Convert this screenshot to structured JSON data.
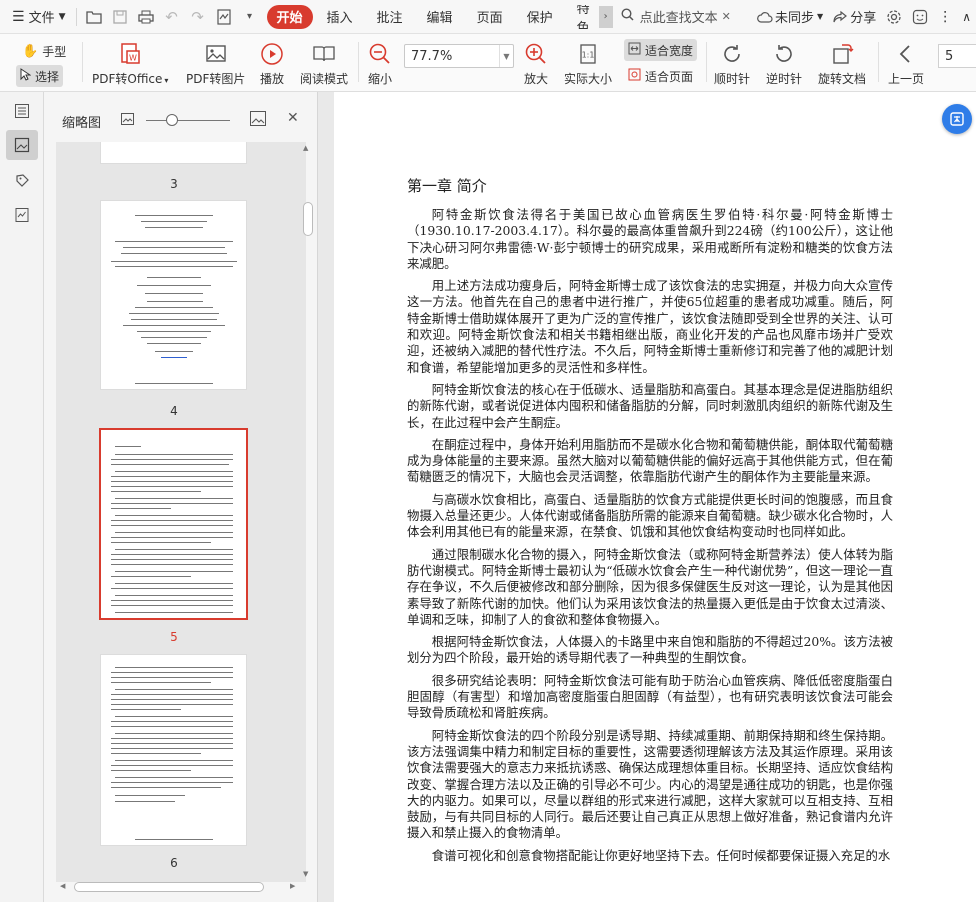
{
  "menubar": {
    "file_label": "文件",
    "tabs": [
      "开始",
      "插入",
      "批注",
      "编辑",
      "页面",
      "保护",
      "特色"
    ],
    "active_tab": "开始",
    "search_label": "点此查找文本",
    "sync_label": "未同步",
    "share_label": "分享"
  },
  "toolbar": {
    "hand_label": "手型",
    "select_label": "选择",
    "pdf_to_office": "PDF转Office",
    "pdf_to_image": "PDF转图片",
    "play": "播放",
    "read_mode": "阅读模式",
    "zoom_out": "缩小",
    "zoom_value": "77.7%",
    "zoom_in": "放大",
    "actual_size": "实际大小",
    "fit_width": "适合宽度",
    "fit_page": "适合页面",
    "rotate_cw": "顺时针",
    "rotate_ccw": "逆时针",
    "rotate_doc": "旋转文档",
    "prev_page": "上一页",
    "page_input": "5"
  },
  "thumbnail_panel": {
    "title": "缩略图",
    "pages": [
      "3",
      "4",
      "5",
      "6"
    ],
    "selected_page": "5"
  },
  "document": {
    "chapter_title": "第一章 简介",
    "paragraphs": [
      "阿特金斯饮食法得名于美国已故心血管病医生罗伯特·科尔曼·阿特金斯博士（1930.10.17-2003.4.17）。科尔曼的最高体重曾飙升到224磅（约100公斤），这让他下决心研习阿尔弗雷德·W·彭宁顿博士的研究成果，采用戒断所有淀粉和糖类的饮食方法来减肥。",
      "用上述方法成功瘦身后，阿特金斯博士成了该饮食法的忠实拥趸，并极力向大众宣传这一方法。他首先在自己的患者中进行推广，并使65位超重的患者成功减重。随后，阿特金斯博士借助媒体展开了更为广泛的宣传推广，该饮食法随即受到全世界的关注、认可和欢迎。阿特金斯饮食法和相关书籍相继出版，商业化开发的产品也风靡市场并广受欢迎，还被纳入减肥的替代性疗法。不久后，阿特金斯博士重新修订和完善了他的减肥计划和食谱，希望能增加更多的灵活性和多样性。",
      "阿特金斯饮食法的核心在于低碳水、适量脂肪和高蛋白。其基本理念是促进脂肪组织的新陈代谢，或者说促进体内囤积和储备脂肪的分解，同时刺激肌肉组织的新陈代谢及生长，在此过程中会产生酮症。",
      "在酮症过程中，身体开始利用脂肪而不是碳水化合物和葡萄糖供能，酮体取代葡萄糖成为身体能量的主要来源。虽然大脑对以葡萄糖供能的偏好远高于其他供能方式，但在葡萄糖匮乏的情况下，大脑也会灵活调整，依靠脂肪代谢产生的酮体作为主要能量来源。",
      "与高碳水饮食相比，高蛋白、适量脂肪的饮食方式能提供更长时间的饱腹感，而且食物摄入总量还更少。人体代谢或储备脂肪所需的能源来自葡萄糖。缺少碳水化合物时，人体会利用其他已有的能量来源，在禁食、饥饿和其他饮食结构变动时也同样如此。",
      "通过限制碳水化合物的摄入，阿特金斯饮食法（或称阿特金斯营养法）使人体转为脂肪代谢模式。阿特金斯博士最初认为“低碳水饮食会产生一种代谢优势”，但这一理论一直存在争议，不久后便被修改和部分删除，因为很多保健医生反对这一理论，认为是其他因素导致了新陈代谢的加快。他们认为采用该饮食法的热量摄入更低是由于饮食太过清淡、单调和乏味，抑制了人的食欲和整体食物摄入。",
      "根据阿特金斯饮食法，人体摄入的卡路里中来自饱和脂肪的不得超过20%。该方法被划分为四个阶段，最开始的诱导期代表了一种典型的生酮饮食。",
      "很多研究结论表明：阿特金斯饮食法可能有助于防治心血管疾病、降低低密度脂蛋白胆固醇（有害型）和增加高密度脂蛋白胆固醇（有益型），也有研究表明该饮食法可能会导致骨质疏松和肾脏疾病。",
      "阿特金斯饮食法的四个阶段分别是诱导期、持续减重期、前期保持期和终生保持期。该方法强调集中精力和制定目标的重要性，这需要透彻理解该方法及其运作原理。采用该饮食法需要强大的意志力来抵抗诱惑、确保达成理想体重目标。长期坚持、适应饮食结构改变、掌握合理方法以及正确的引导必不可少。内心的渴望是通往成功的钥匙，也是你强大的内驱力。如果可以，尽量以群组的形式来进行减肥，这样大家就可以互相支持、互相鼓励，与有共同目标的人同行。最后还要让自己真正从思想上做好准备，熟记食谱内允许摄入和禁止摄入的食物清单。",
      "食谱可视化和创意食物搭配能让你更好地坚持下去。任何时候都要保证摄入充足的水"
    ]
  }
}
